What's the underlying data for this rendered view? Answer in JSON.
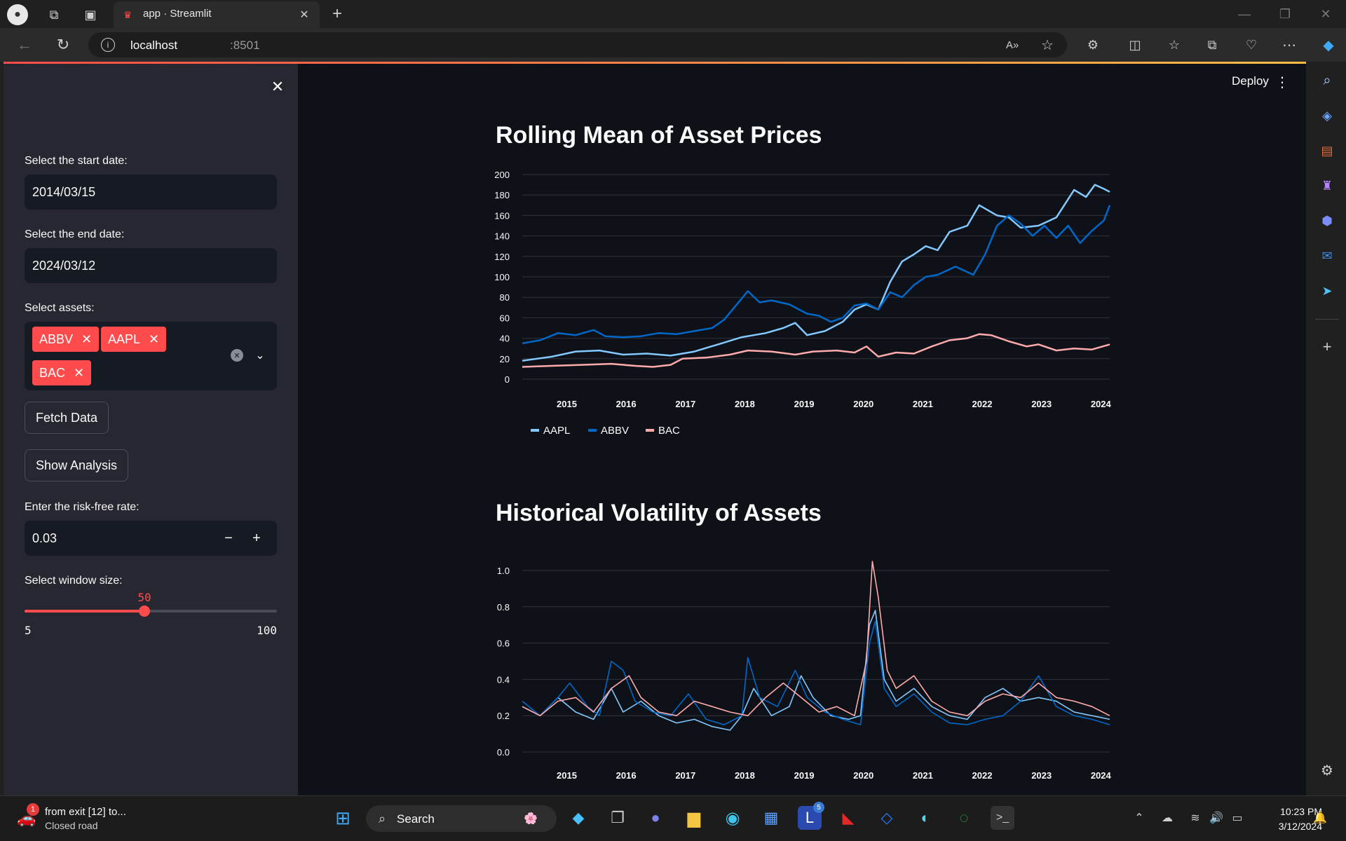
{
  "browser": {
    "tab_title": "app · Streamlit",
    "url_host": "localhost",
    "url_port": ":8501"
  },
  "sidebar": {
    "start_label": "Select the start date:",
    "start_value": "2014/03/15",
    "end_label": "Select the end date:",
    "end_value": "2024/03/12",
    "assets_label": "Select assets:",
    "assets": [
      "ABBV",
      "AAPL",
      "BAC"
    ],
    "fetch_button": "Fetch Data",
    "analysis_button": "Show Analysis",
    "rate_label": "Enter the risk-free rate:",
    "rate_value": "0.03",
    "window_label": "Select window size:",
    "window_value": "50",
    "window_min": "5",
    "window_max": "100",
    "window_fraction": 0.4737
  },
  "header": {
    "deploy": "Deploy"
  },
  "colors": {
    "AAPL": "#83c9ff",
    "ABBV": "#0068c9",
    "BAC": "#ffabab",
    "accent": "#ff4b4b"
  },
  "chart_titles": {
    "rolling": "Rolling Mean of Asset Prices",
    "vol": "Historical Volatility of Assets"
  },
  "chart_data": [
    {
      "type": "line",
      "title": "Rolling Mean of Asset Prices",
      "x_ticks": [
        "2015",
        "2016",
        "2017",
        "2018",
        "2019",
        "2020",
        "2021",
        "2022",
        "2023",
        "2024"
      ],
      "y_ticks": [
        0,
        20,
        40,
        60,
        80,
        100,
        120,
        140,
        160,
        180,
        200
      ],
      "ylim": [
        0,
        200
      ],
      "xlim": [
        2014.3,
        2024.2
      ],
      "legend": "bottom-left",
      "series": [
        {
          "name": "AAPL",
          "color": "#83c9ff",
          "x": [
            2014.3,
            2014.8,
            2015.2,
            2015.6,
            2016.0,
            2016.4,
            2016.8,
            2017.2,
            2017.6,
            2018.0,
            2018.4,
            2018.7,
            2018.9,
            2019.1,
            2019.4,
            2019.7,
            2019.9,
            2020.1,
            2020.3,
            2020.5,
            2020.7,
            2020.9,
            2021.1,
            2021.3,
            2021.5,
            2021.8,
            2022.0,
            2022.3,
            2022.5,
            2022.7,
            2023.0,
            2023.3,
            2023.6,
            2023.8,
            2023.95,
            2024.1,
            2024.2
          ],
          "values": [
            18,
            22,
            27,
            28,
            24,
            25,
            23,
            27,
            34,
            41,
            45,
            50,
            55,
            43,
            47,
            56,
            68,
            73,
            68,
            95,
            115,
            122,
            130,
            126,
            144,
            150,
            170,
            160,
            158,
            148,
            150,
            158,
            185,
            178,
            190,
            186,
            183
          ]
        },
        {
          "name": "ABBV",
          "color": "#0068c9",
          "x": [
            2014.3,
            2014.6,
            2014.9,
            2015.2,
            2015.5,
            2015.7,
            2016.0,
            2016.3,
            2016.6,
            2016.9,
            2017.2,
            2017.5,
            2017.7,
            2017.9,
            2018.1,
            2018.3,
            2018.5,
            2018.8,
            2019.1,
            2019.3,
            2019.5,
            2019.7,
            2019.9,
            2020.1,
            2020.3,
            2020.5,
            2020.7,
            2020.9,
            2021.1,
            2021.3,
            2021.6,
            2021.9,
            2022.1,
            2022.3,
            2022.5,
            2022.7,
            2022.9,
            2023.1,
            2023.3,
            2023.5,
            2023.7,
            2023.9,
            2024.1,
            2024.2
          ],
          "values": [
            35,
            38,
            45,
            43,
            48,
            42,
            41,
            42,
            45,
            44,
            47,
            50,
            58,
            72,
            86,
            75,
            77,
            73,
            64,
            62,
            56,
            60,
            72,
            74,
            68,
            85,
            80,
            92,
            100,
            102,
            110,
            102,
            122,
            150,
            160,
            152,
            140,
            150,
            138,
            150,
            133,
            145,
            155,
            170
          ]
        },
        {
          "name": "BAC",
          "color": "#ffabab",
          "x": [
            2014.3,
            2014.8,
            2015.3,
            2015.8,
            2016.2,
            2016.5,
            2016.8,
            2017.0,
            2017.4,
            2017.8,
            2018.1,
            2018.5,
            2018.9,
            2019.2,
            2019.6,
            2019.9,
            2020.1,
            2020.3,
            2020.6,
            2020.9,
            2021.2,
            2021.5,
            2021.8,
            2022.0,
            2022.2,
            2022.5,
            2022.8,
            2023.0,
            2023.3,
            2023.6,
            2023.9,
            2024.2
          ],
          "values": [
            12,
            13,
            14,
            15,
            13,
            12,
            14,
            20,
            21,
            24,
            28,
            27,
            24,
            27,
            28,
            26,
            32,
            22,
            26,
            25,
            32,
            38,
            40,
            44,
            43,
            37,
            32,
            34,
            28,
            30,
            29,
            34
          ]
        }
      ]
    },
    {
      "type": "line",
      "title": "Historical Volatility of Assets",
      "x_ticks": [
        "2015",
        "2016",
        "2017",
        "2018",
        "2019",
        "2020",
        "2021",
        "2022",
        "2023",
        "2024"
      ],
      "y_ticks": [
        0.0,
        0.2,
        0.4,
        0.6,
        0.8,
        1.0
      ],
      "ylim": [
        0,
        1.05
      ],
      "xlim": [
        2014.3,
        2024.2
      ],
      "series": [
        {
          "name": "AAPL",
          "color": "#83c9ff",
          "x": [
            2014.3,
            2014.6,
            2014.9,
            2015.2,
            2015.5,
            2015.8,
            2016.0,
            2016.3,
            2016.6,
            2016.9,
            2017.2,
            2017.5,
            2017.8,
            2018.0,
            2018.2,
            2018.5,
            2018.8,
            2019.0,
            2019.2,
            2019.5,
            2019.8,
            2020.0,
            2020.15,
            2020.25,
            2020.4,
            2020.6,
            2020.9,
            2021.2,
            2021.5,
            2021.8,
            2022.1,
            2022.4,
            2022.7,
            2023.0,
            2023.3,
            2023.6,
            2023.9,
            2024.2
          ],
          "values": [
            0.25,
            0.2,
            0.3,
            0.22,
            0.18,
            0.35,
            0.22,
            0.28,
            0.2,
            0.16,
            0.18,
            0.14,
            0.12,
            0.2,
            0.35,
            0.2,
            0.25,
            0.42,
            0.3,
            0.2,
            0.18,
            0.2,
            0.7,
            0.78,
            0.4,
            0.28,
            0.35,
            0.25,
            0.2,
            0.18,
            0.3,
            0.35,
            0.28,
            0.3,
            0.28,
            0.22,
            0.2,
            0.18
          ]
        },
        {
          "name": "ABBV",
          "color": "#0068c9",
          "x": [
            2014.3,
            2014.6,
            2014.9,
            2015.1,
            2015.4,
            2015.6,
            2015.8,
            2016.0,
            2016.2,
            2016.5,
            2016.8,
            2017.1,
            2017.4,
            2017.7,
            2018.0,
            2018.1,
            2018.3,
            2018.6,
            2018.9,
            2019.1,
            2019.4,
            2019.7,
            2020.0,
            2020.15,
            2020.25,
            2020.4,
            2020.6,
            2020.9,
            2021.2,
            2021.5,
            2021.8,
            2022.1,
            2022.4,
            2022.7,
            2023.0,
            2023.3,
            2023.6,
            2023.9,
            2024.2
          ],
          "values": [
            0.28,
            0.2,
            0.3,
            0.38,
            0.25,
            0.2,
            0.5,
            0.45,
            0.28,
            0.22,
            0.2,
            0.32,
            0.18,
            0.15,
            0.2,
            0.52,
            0.3,
            0.25,
            0.45,
            0.3,
            0.22,
            0.18,
            0.15,
            0.6,
            0.72,
            0.35,
            0.25,
            0.32,
            0.22,
            0.16,
            0.15,
            0.18,
            0.2,
            0.28,
            0.42,
            0.25,
            0.2,
            0.18,
            0.15
          ]
        },
        {
          "name": "BAC",
          "color": "#ffabab",
          "x": [
            2014.3,
            2014.6,
            2014.9,
            2015.2,
            2015.5,
            2015.8,
            2016.1,
            2016.3,
            2016.6,
            2016.9,
            2017.2,
            2017.5,
            2017.8,
            2018.1,
            2018.4,
            2018.7,
            2019.0,
            2019.3,
            2019.6,
            2019.9,
            2020.1,
            2020.2,
            2020.3,
            2020.45,
            2020.6,
            2020.9,
            2021.2,
            2021.5,
            2021.8,
            2022.1,
            2022.4,
            2022.7,
            2023.0,
            2023.3,
            2023.6,
            2023.9,
            2024.2
          ],
          "values": [
            0.25,
            0.2,
            0.28,
            0.3,
            0.22,
            0.35,
            0.42,
            0.3,
            0.22,
            0.2,
            0.28,
            0.25,
            0.22,
            0.2,
            0.3,
            0.38,
            0.3,
            0.22,
            0.25,
            0.2,
            0.5,
            1.05,
            0.85,
            0.45,
            0.35,
            0.42,
            0.28,
            0.22,
            0.2,
            0.28,
            0.32,
            0.3,
            0.38,
            0.3,
            0.28,
            0.25,
            0.2
          ]
        }
      ]
    }
  ],
  "taskbar": {
    "notif_title": "from exit [12] to...",
    "notif_sub": "Closed road",
    "notif_badge": "1",
    "search": "Search",
    "mail_badge": "5",
    "time": "10:23 PM",
    "date": "3/12/2024"
  }
}
